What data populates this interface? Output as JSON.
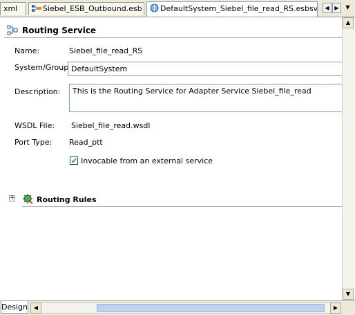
{
  "tabs": [
    {
      "label": "xml",
      "active": false
    },
    {
      "label": "Siebel_ESB_Outbound.esb",
      "active": false
    },
    {
      "label": "DefaultSystem_Siebel_file_read_RS.esbsvc",
      "active": true
    }
  ],
  "routing_service": {
    "title": "Routing Service",
    "name_label": "Name:",
    "name_value": "Siebel_file_read_RS",
    "system_label": "System/Group:",
    "system_value": "DefaultSystem",
    "description_label": "Description:",
    "description_value": "This is the Routing Service for Adapter Service Siebel_file_read",
    "wsdl_label": "WSDL File:",
    "wsdl_value": "Siebel_file_read.wsdl",
    "port_label": "Port Type:",
    "port_value": "Read_ptt",
    "invocable_label": "Invocable from an external service",
    "invocable_checked": true
  },
  "routing_rules": {
    "title": "Routing Rules",
    "expand": "+"
  },
  "bottom": {
    "design_tab": "Design"
  }
}
